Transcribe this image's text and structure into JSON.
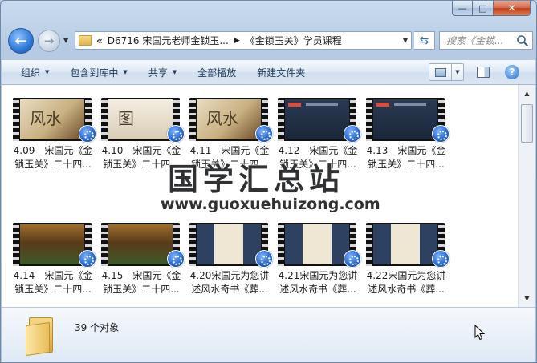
{
  "window": {
    "caption": {
      "minimize": "—",
      "maximize": "□",
      "close": "✕"
    }
  },
  "nav": {
    "back_icon": "arrow-left",
    "forward_icon": "arrow-right"
  },
  "address": {
    "chevrons": "«",
    "segments": [
      "D6716 宋国元老师金锁玉...",
      "《金锁玉关》学员课程"
    ]
  },
  "search": {
    "placeholder": "搜索《金锁..."
  },
  "toolbar": {
    "organize": "组织",
    "include_in_library": "包含到库中",
    "share": "共享",
    "play_all": "全部播放",
    "new_folder": "新建文件夹"
  },
  "files": [
    {
      "label": "4.09　宋国元《金锁玉关》二十四...",
      "thumb": "brown",
      "thumb_text": "风水"
    },
    {
      "label": "4.10　宋国元《金锁玉关》二十四...",
      "thumb": "paper",
      "thumb_text": "图"
    },
    {
      "label": "4.11　宋国元《金锁玉关》二十四...",
      "thumb": "brown",
      "thumb_text": "风水"
    },
    {
      "label": "4.12　宋国元《金锁玉关》二十四...",
      "thumb": "dark",
      "thumb_text": ""
    },
    {
      "label": "4.13　宋国元《金锁玉关》二十四...",
      "thumb": "dark",
      "thumb_text": ""
    },
    {
      "label": "4.14　宋国元《金锁玉关》二十四...",
      "thumb": "red",
      "thumb_text": ""
    },
    {
      "label": "4.15　宋国元《金锁玉关》二十四...",
      "thumb": "red",
      "thumb_text": ""
    },
    {
      "label": "4.20宋国元为您讲述风水奇书《葬...",
      "thumb": "scroll",
      "thumb_text": ""
    },
    {
      "label": "4.21宋国元为您讲述风水奇书《葬...",
      "thumb": "scroll",
      "thumb_text": ""
    },
    {
      "label": "4.22宋国元为您讲述风水奇书《葬...",
      "thumb": "scroll",
      "thumb_text": ""
    }
  ],
  "watermark": {
    "title": "国学汇总站",
    "url": "www.guoxuehuizong.com"
  },
  "details": {
    "count": "39 个对象"
  }
}
